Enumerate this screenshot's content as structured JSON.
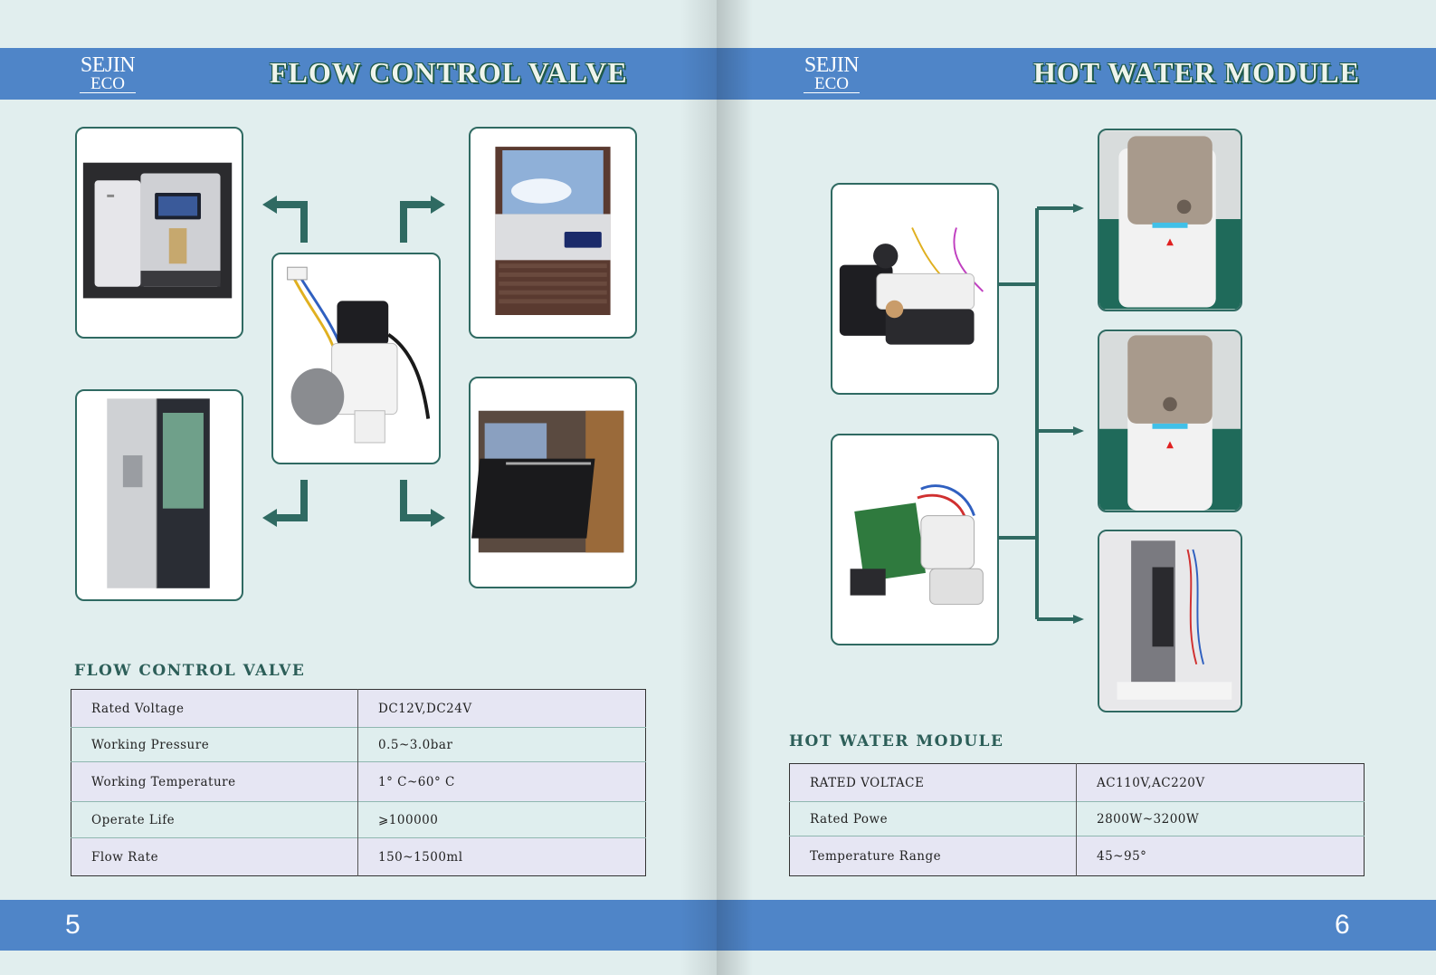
{
  "brand": {
    "line1": "SEJIN",
    "line2": "ECO"
  },
  "left_page": {
    "header_title": "FLOW CONTROL VALVE",
    "section_title": "FLOW CONTROL VALVE",
    "page_number": "5",
    "specs": [
      {
        "label": "Rated Voltage",
        "value": "DC12V,DC24V"
      },
      {
        "label": "Working Pressure",
        "value": "0.5~3.0bar"
      },
      {
        "label": "Working Temperature",
        "value": "1° C~60° C"
      },
      {
        "label": "Operate Life",
        "value": "⩾100000"
      },
      {
        "label": "Flow Rate",
        "value": "150~1500ml"
      }
    ]
  },
  "right_page": {
    "header_title": "HOT WATER MODULE",
    "section_title": "HOT WATER MODULE",
    "page_number": "6",
    "specs": [
      {
        "label": "RATED VOLTACE",
        "value": "AC110V,AC220V"
      },
      {
        "label": "Rated Powe",
        "value": "2800W~3200W"
      },
      {
        "label": "Temperature  Range",
        "value": "45~95°"
      }
    ]
  },
  "colors": {
    "band": "#4f85c8",
    "page_bg": "#e1eeee",
    "accent": "#2f6a62"
  }
}
